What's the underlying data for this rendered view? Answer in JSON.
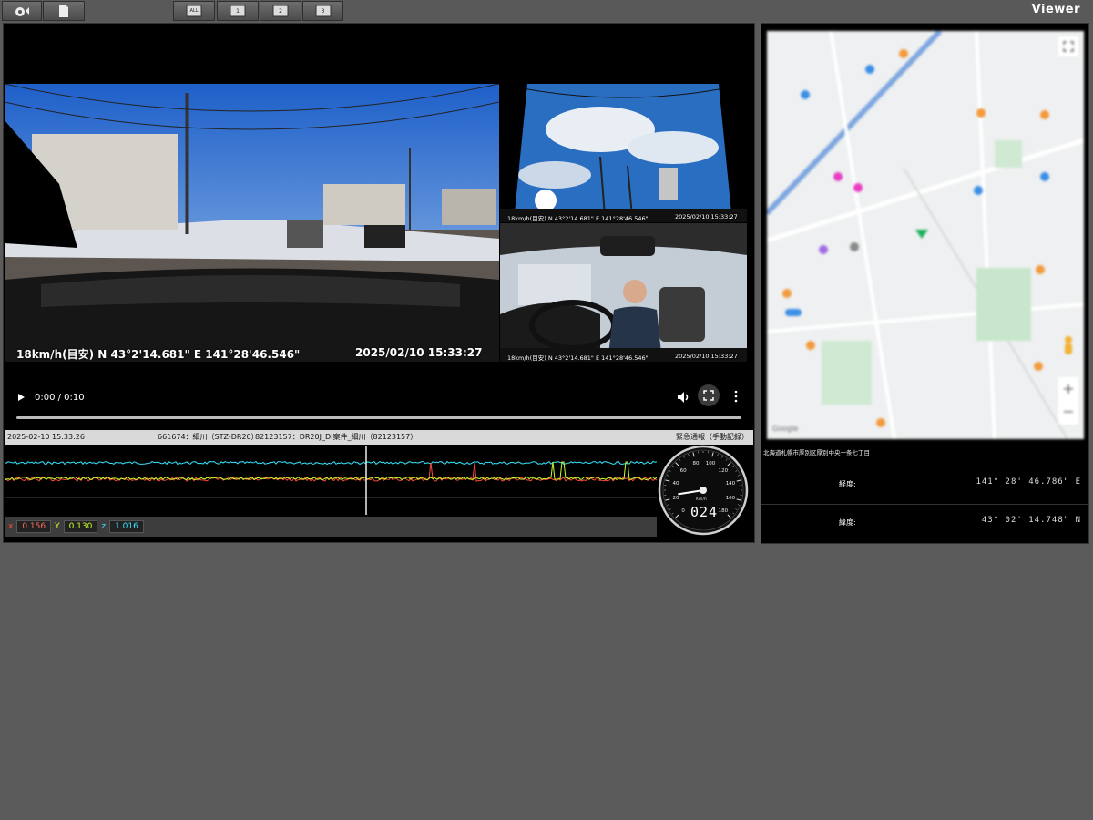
{
  "toolbar": {
    "viewer_label": "Viewer",
    "buttons": [
      {
        "name": "settings",
        "icon": "gear-upload-icon"
      },
      {
        "name": "export",
        "icon": "document-icon"
      },
      {
        "name": "view-all",
        "label": "ALL"
      },
      {
        "name": "view-1",
        "label": "1"
      },
      {
        "name": "view-2",
        "label": "2"
      },
      {
        "name": "view-3",
        "label": "3"
      }
    ]
  },
  "main_camera": {
    "overlay": "18km/h(目安)  N 43°2'14.681\"  E 141°28'46.546\"",
    "timestamp": "2025/02/10 15:33:27"
  },
  "rear_camera": {
    "overlay": "18km/h(目安)  N 43°2'14.681\"  E 141°28'46.546\"",
    "timestamp": "2025/02/10 15:33:27"
  },
  "cabin_camera": {
    "overlay": "18km/h(目安)  N 43°2'14.681\"  E 141°28'46.546\"",
    "timestamp": "2025/02/10 15:33:27"
  },
  "player": {
    "time": "0:00 / 0:10",
    "progress": 0
  },
  "info_bar": {
    "datetime": "2025-02-10 15:33:26",
    "vehicle": "661674：細川（STZ-DR20）",
    "device": "82123157：DR20J_DI案件_細川（82123157）",
    "event": "緊急通報（手動記録）"
  },
  "accel": {
    "x_label": "x",
    "x_value": "0.156",
    "y_label": "Y",
    "y_value": "0.130",
    "z_label": "z",
    "z_value": "1.016",
    "colors": {
      "x": "#ff4a3a",
      "y": "#c8ff2a",
      "z": "#36e6ff"
    }
  },
  "speedometer": {
    "unit": "Km/h",
    "reading": "024",
    "ticks": [
      "0",
      "20",
      "40",
      "60",
      "80",
      "100",
      "120",
      "140",
      "160",
      "180"
    ],
    "value": 24
  },
  "map": {
    "address": "北海道札幌市厚別区厚別中央一条七丁目",
    "google_label": "Google"
  },
  "coords": {
    "longitude_label": "経度:",
    "longitude_value": "141° 28' 46.786\" E",
    "latitude_label": "緯度:",
    "latitude_value": "43° 02' 14.748\" N"
  }
}
